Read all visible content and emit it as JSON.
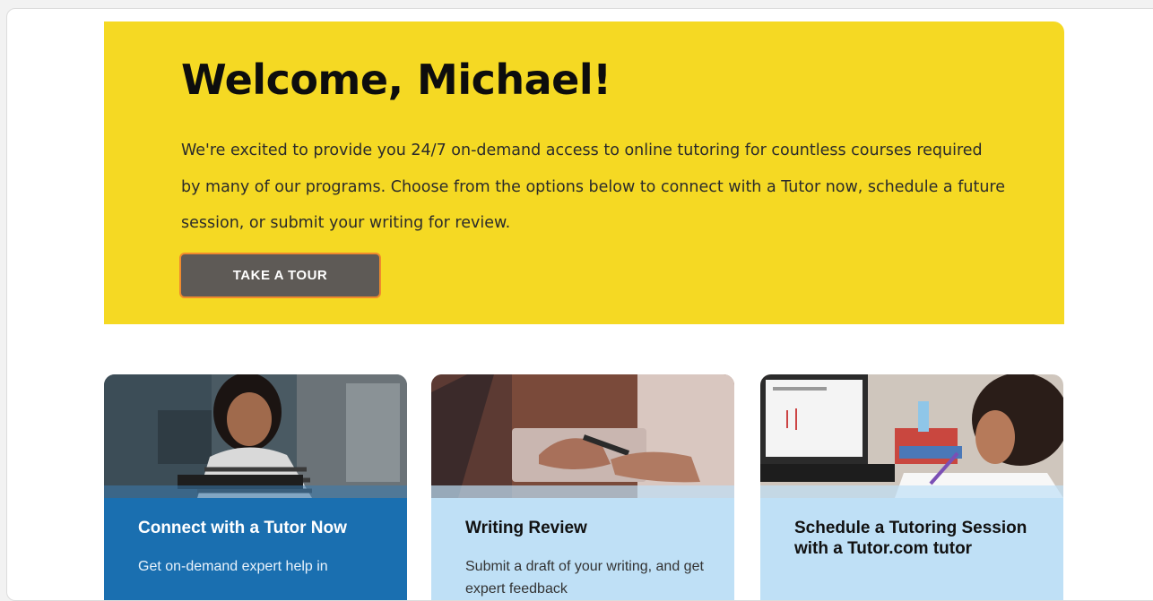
{
  "hero": {
    "title": "Welcome, Michael!",
    "description": "We're excited to provide you 24/7 on-demand access to online tutoring for countless courses required by many of our programs. Choose from the options below to connect with a Tutor now, schedule a future session, or submit your writing for review.",
    "button_label": "TAKE A TOUR"
  },
  "cards": [
    {
      "title": "Connect with a Tutor Now",
      "description": "Get on-demand expert help in"
    },
    {
      "title": "Writing Review",
      "description": "Submit a draft of your writing, and get expert feedback"
    },
    {
      "title": "Schedule a Tutoring Session with a Tutor.com tutor",
      "description": ""
    }
  ],
  "colors": {
    "hero_background": "#f5d923",
    "button_background": "#5e5a56",
    "button_border": "#f08a2d",
    "primary_card": "#1a6fb0",
    "secondary_card": "#bfe0f6"
  }
}
